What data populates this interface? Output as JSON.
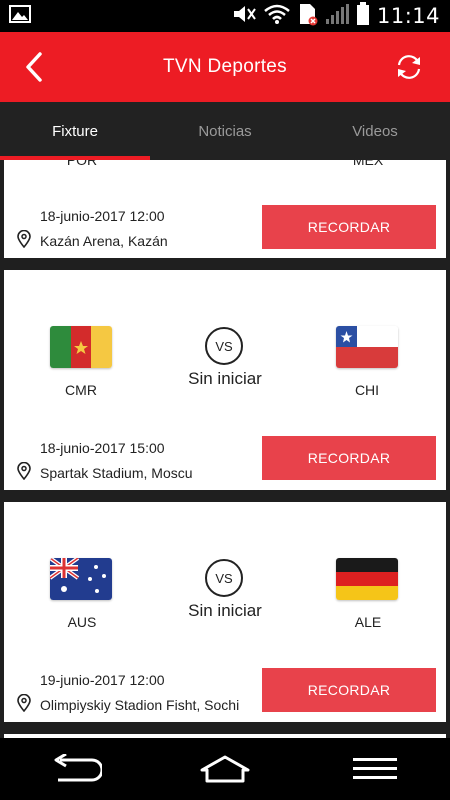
{
  "status_bar": {
    "time": "11:14"
  },
  "app_bar": {
    "title": "TVN Deportes"
  },
  "tabs": [
    {
      "label": "Fixture",
      "active": true
    },
    {
      "label": "Noticias",
      "active": false
    },
    {
      "label": "Videos",
      "active": false
    }
  ],
  "matches": [
    {
      "home_code": "POR",
      "away_code": "MEX",
      "date": "18-junio-2017 12:00",
      "venue": "Kazán Arena, Kazán",
      "button": "RECORDAR"
    },
    {
      "home_code": "CMR",
      "away_code": "CHI",
      "vs": "VS",
      "status": "Sin iniciar",
      "date": "18-junio-2017 15:00",
      "venue": "Spartak Stadium, Moscu",
      "button": "RECORDAR"
    },
    {
      "home_code": "AUS",
      "away_code": "ALE",
      "vs": "VS",
      "status": "Sin iniciar",
      "date": "19-junio-2017 12:00",
      "venue": "Olimpiyskiy Stadion Fisht, Sochi",
      "button": "RECORDAR"
    }
  ],
  "colors": {
    "primary": "#ed1c24",
    "button": "#e8424b",
    "tab_bg": "#222222"
  },
  "icons": {
    "status_left": "picture-icon",
    "status_right": [
      "mute-icon",
      "wifi-icon",
      "sim-icon",
      "signal-icon",
      "battery-icon"
    ],
    "app_bar": [
      "back-arrow-icon",
      "refresh-icon"
    ],
    "nav": [
      "back-nav-icon",
      "home-nav-icon",
      "menu-nav-icon"
    ]
  }
}
